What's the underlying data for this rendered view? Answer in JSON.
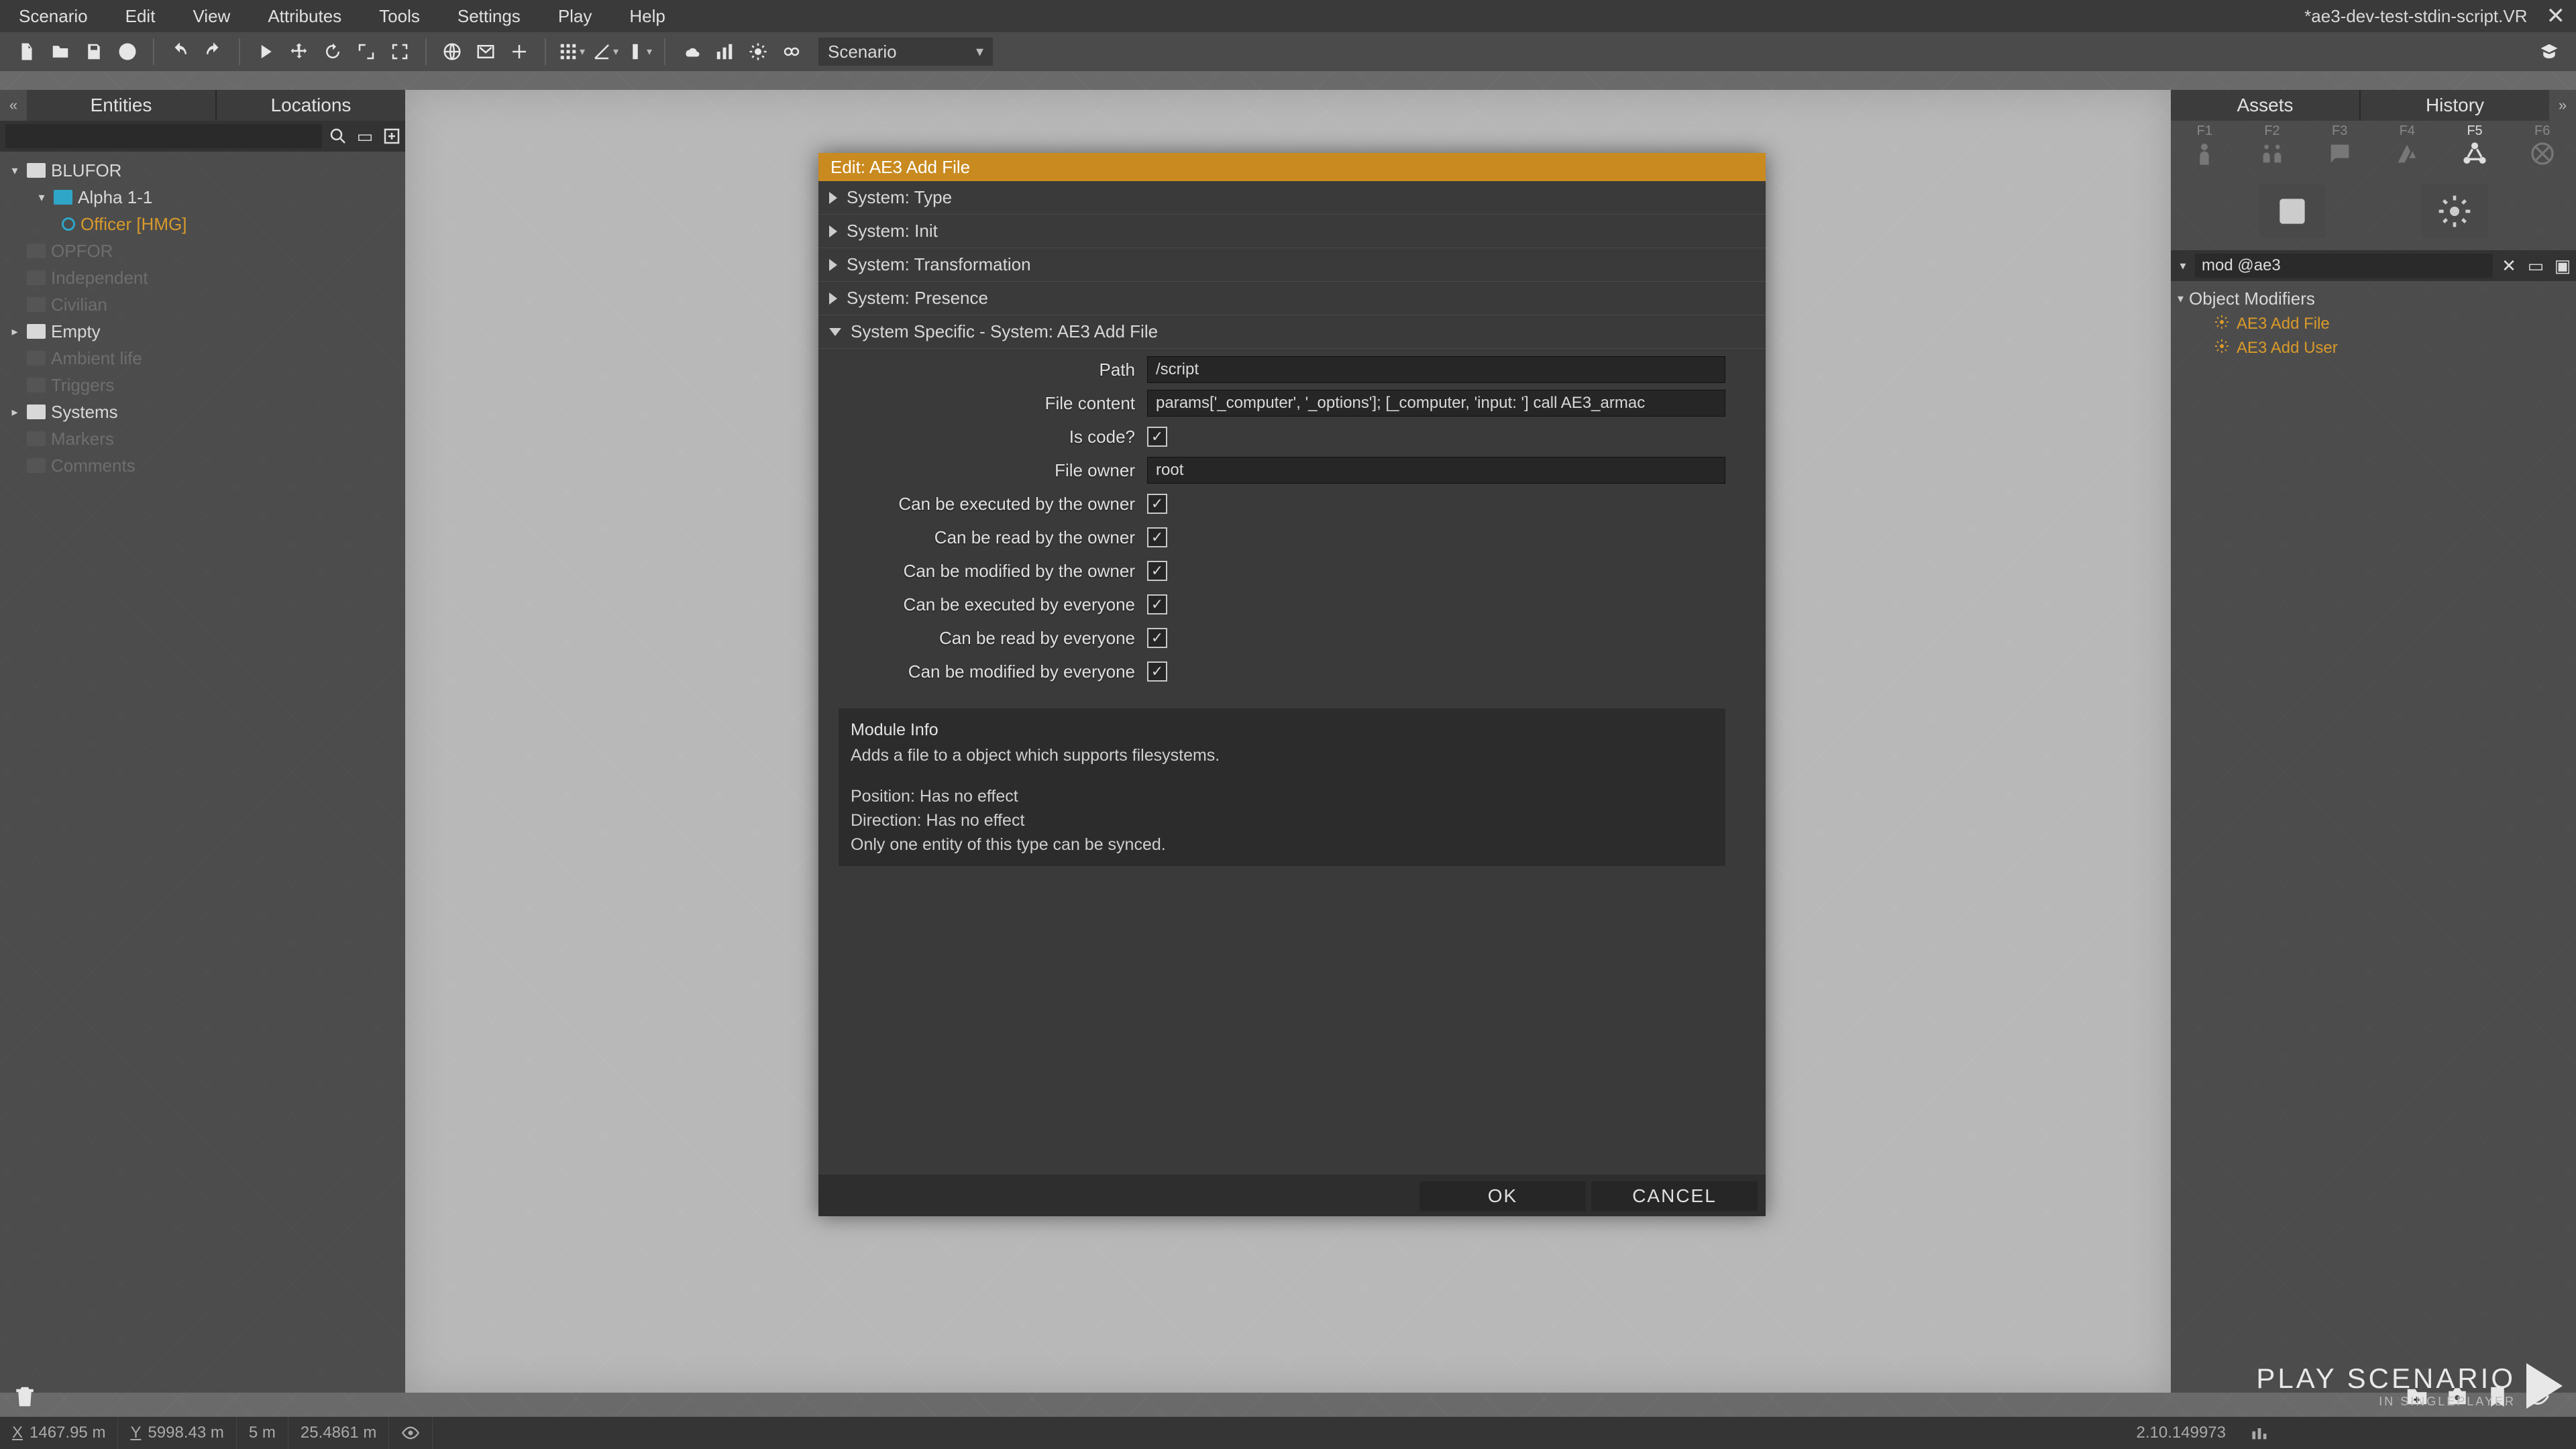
{
  "menubar": {
    "items": [
      "Scenario",
      "Edit",
      "View",
      "Attributes",
      "Tools",
      "Settings",
      "Play",
      "Help"
    ],
    "doc_title": "*ae3-dev-test-stdin-script.VR"
  },
  "toolbar": {
    "scenario_label": "Scenario"
  },
  "left_panel": {
    "tab_entities": "Entities",
    "tab_locations": "Locations",
    "search": "",
    "tree": {
      "blufor": "BLUFOR",
      "alpha": "Alpha 1-1",
      "officer": "Officer [HMG]",
      "opfor": "OPFOR",
      "independent": "Independent",
      "civilian": "Civilian",
      "empty": "Empty",
      "ambient": "Ambient life",
      "triggers": "Triggers",
      "systems": "Systems",
      "markers": "Markers",
      "comments": "Comments"
    }
  },
  "right_panel": {
    "tab_assets": "Assets",
    "tab_history": "History",
    "fkeys": [
      "F1",
      "F2",
      "F3",
      "F4",
      "F5",
      "F6"
    ],
    "mod_value": "mod @ae3",
    "obj_mod_header": "Object Modifiers",
    "obj_items": [
      "AE3 Add File",
      "AE3 Add User"
    ]
  },
  "modal": {
    "title": "Edit: AE3 Add File",
    "sections": [
      "System: Type",
      "System: Init",
      "System: Transformation",
      "System: Presence",
      "System Specific - System: AE3 Add File"
    ],
    "fields": {
      "path_label": "Path",
      "path_value": "/script",
      "content_label": "File content",
      "content_value": "params['_computer', '_options']; [_computer, 'input: '] call AE3_armac",
      "iscode_label": "Is code?",
      "owner_label": "File owner",
      "owner_value": "root",
      "exec_owner": "Can be executed by the owner",
      "read_owner": "Can be read by the owner",
      "mod_owner": "Can be modified by the owner",
      "exec_all": "Can be executed by everyone",
      "read_all": "Can be read by everyone",
      "mod_all": "Can be modified by everyone"
    },
    "info": {
      "hdr": "Module Info",
      "l1": "Adds a file to a object which supports filesystems.",
      "l2": "Position: Has no effect",
      "l3": "Direction: Has no effect",
      "l4": "Only one entity of this type can be synced."
    },
    "ok": "OK",
    "cancel": "CANCEL"
  },
  "play": {
    "big": "PLAY SCENARIO",
    "small": "IN SINGLEPLAYER"
  },
  "status": {
    "x": "1467.95 m",
    "y": "5998.43 m",
    "z": "5 m",
    "dist": "25.4861 m",
    "version": "2.10.149973"
  }
}
